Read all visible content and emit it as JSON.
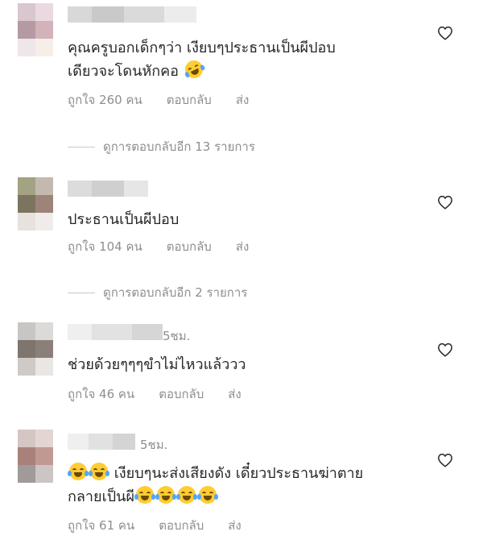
{
  "comments": [
    {
      "time": "",
      "text_lines": [
        "คุณครูบอกเด็กๆว่า เงียบๆประธานเป็นผีปอบ",
        "เดียวจะโดนหักคอ"
      ],
      "emoji": "rolling-on-the-floor-laughing",
      "likes": "ถูกใจ 260 คน",
      "reply": "ตอบกลับ",
      "send": "ส่ง",
      "view_replies": "ดูการตอบกลับอีก 13 รายการ"
    },
    {
      "time": "",
      "text_lines": [
        "ประธานเป็นผีปอบ"
      ],
      "likes": "ถูกใจ 104 คน",
      "reply": "ตอบกลับ",
      "send": "ส่ง",
      "view_replies": "ดูการตอบกลับอีก 2 รายการ"
    },
    {
      "time": "5ชม.",
      "text_lines": [
        "ช่วยด้วยๆๆๆขำไม่ไหวแล้ววว"
      ],
      "likes": "ถูกใจ 46 คน",
      "reply": "ตอบกลับ",
      "send": "ส่ง"
    },
    {
      "time": "5ชม.",
      "text_lines": [
        "เงียบๆนะส่งเสียงดัง เดี๋ยวประธานฆ่าตาย",
        "กลายเป็นผี"
      ],
      "emoji": "face-with-tears-of-joy",
      "likes": "ถูกใจ 61 คน",
      "reply": "ตอบกลับ",
      "send": "ส่ง"
    }
  ],
  "colors": {
    "text": "#262626",
    "secondary": "#8e8e8e",
    "divider": "#c7c7c7",
    "background": "#ffffff"
  }
}
